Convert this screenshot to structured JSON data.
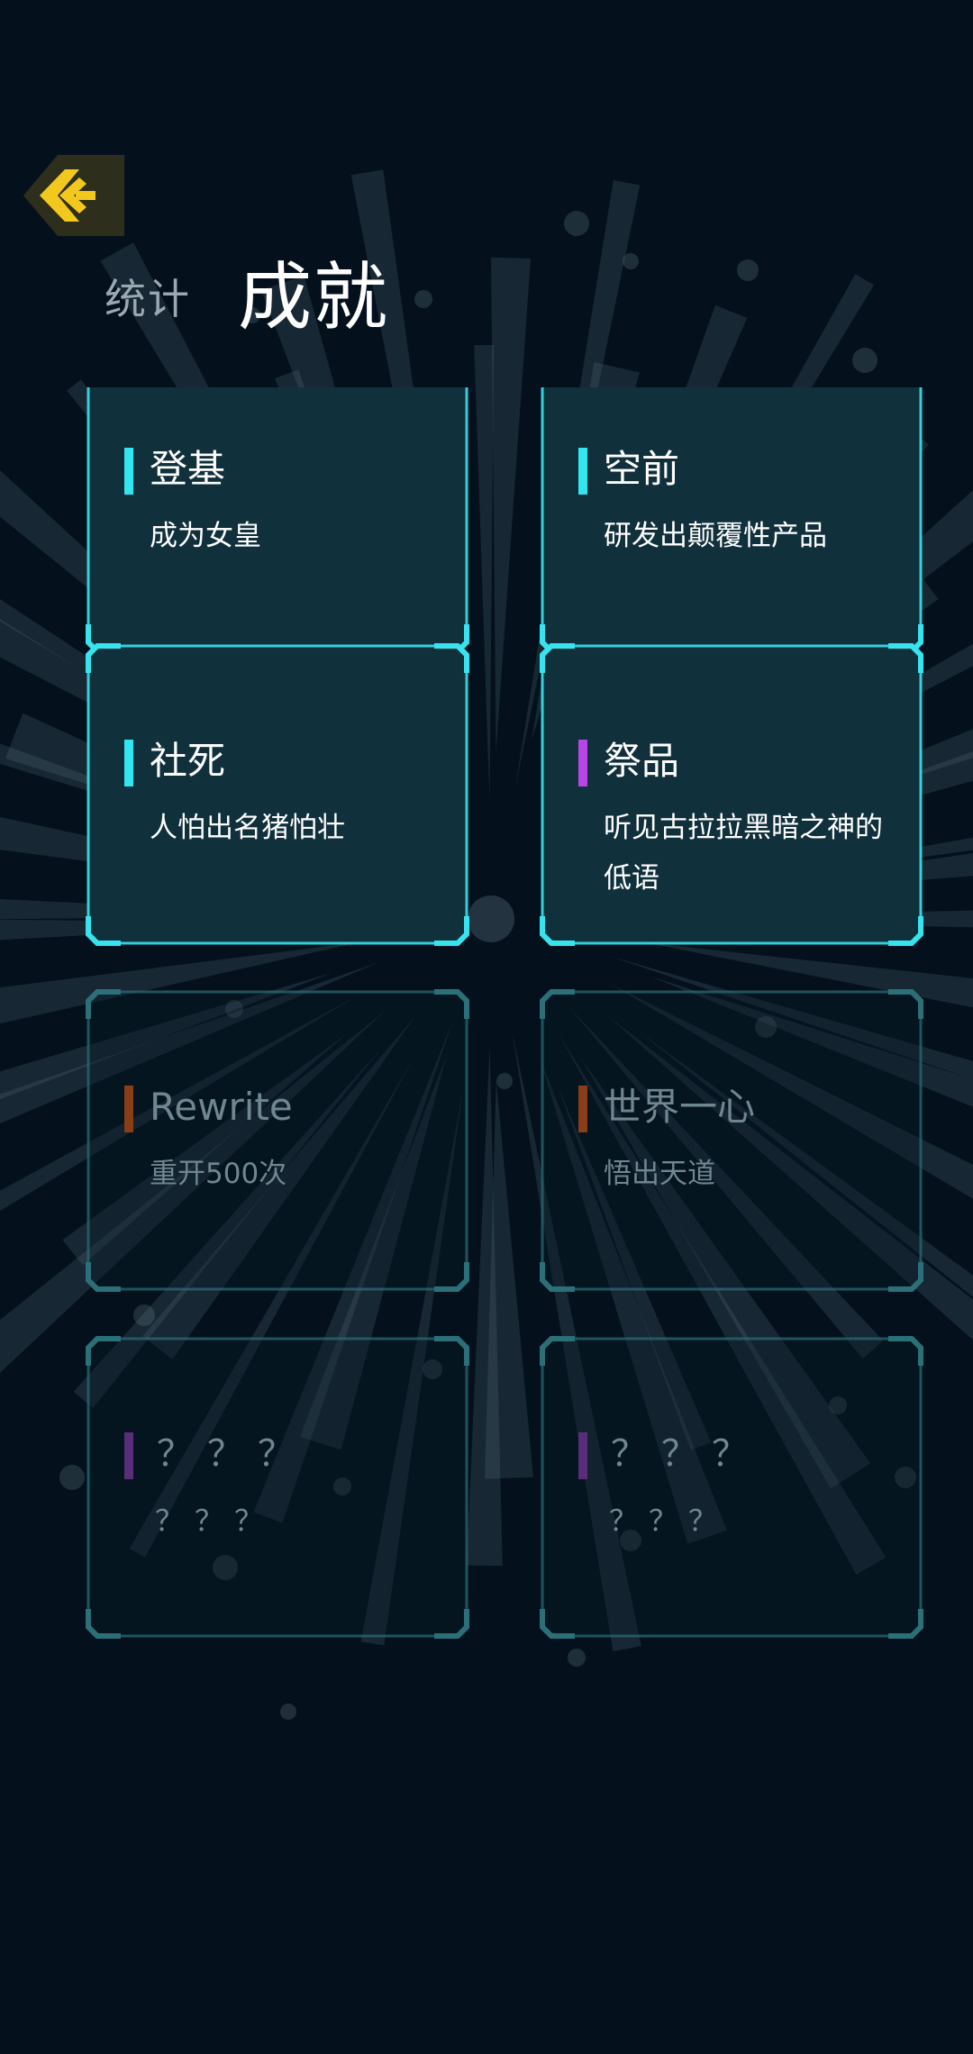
{
  "header": {
    "back_icon": "back-arrow-icon",
    "tabs": [
      {
        "label": "统计",
        "active": false
      },
      {
        "label": "成就",
        "active": true
      }
    ]
  },
  "colors": {
    "background": "#04111d",
    "card_active": "#10303c",
    "card_border_active": "#37e3ee",
    "card_border_locked": "#2b6f78",
    "accent_cyan": "#32e6f0",
    "accent_purple": "#b845e8",
    "accent_brown": "#8a3d16",
    "accent_dark_purple": "#5a2d7a",
    "back_button_yellow": "#f2c81e"
  },
  "achievements": [
    {
      "title": "登基",
      "desc": "成为女皇",
      "state": "unlocked",
      "accent": "#32e6f0"
    },
    {
      "title": "空前",
      "desc": "研发出颠覆性产品",
      "state": "unlocked",
      "accent": "#32e6f0"
    },
    {
      "title": "社死",
      "desc": "人怕出名猪怕壮",
      "state": "unlocked",
      "accent": "#32e6f0"
    },
    {
      "title": "祭品",
      "desc": "听见古拉拉黑暗之神的低语",
      "state": "unlocked",
      "accent": "#b845e8"
    },
    {
      "title": "Rewrite",
      "desc": "重开500次",
      "state": "locked",
      "accent": "#8a3d16"
    },
    {
      "title": "世界一心",
      "desc": "悟出天道",
      "state": "locked",
      "accent": "#8a3d16"
    },
    {
      "title": "？？？",
      "desc": "？？？",
      "state": "mystery",
      "accent": "#5a2d7a"
    },
    {
      "title": "？？？",
      "desc": "？？？",
      "state": "mystery",
      "accent": "#5a2d7a"
    }
  ]
}
